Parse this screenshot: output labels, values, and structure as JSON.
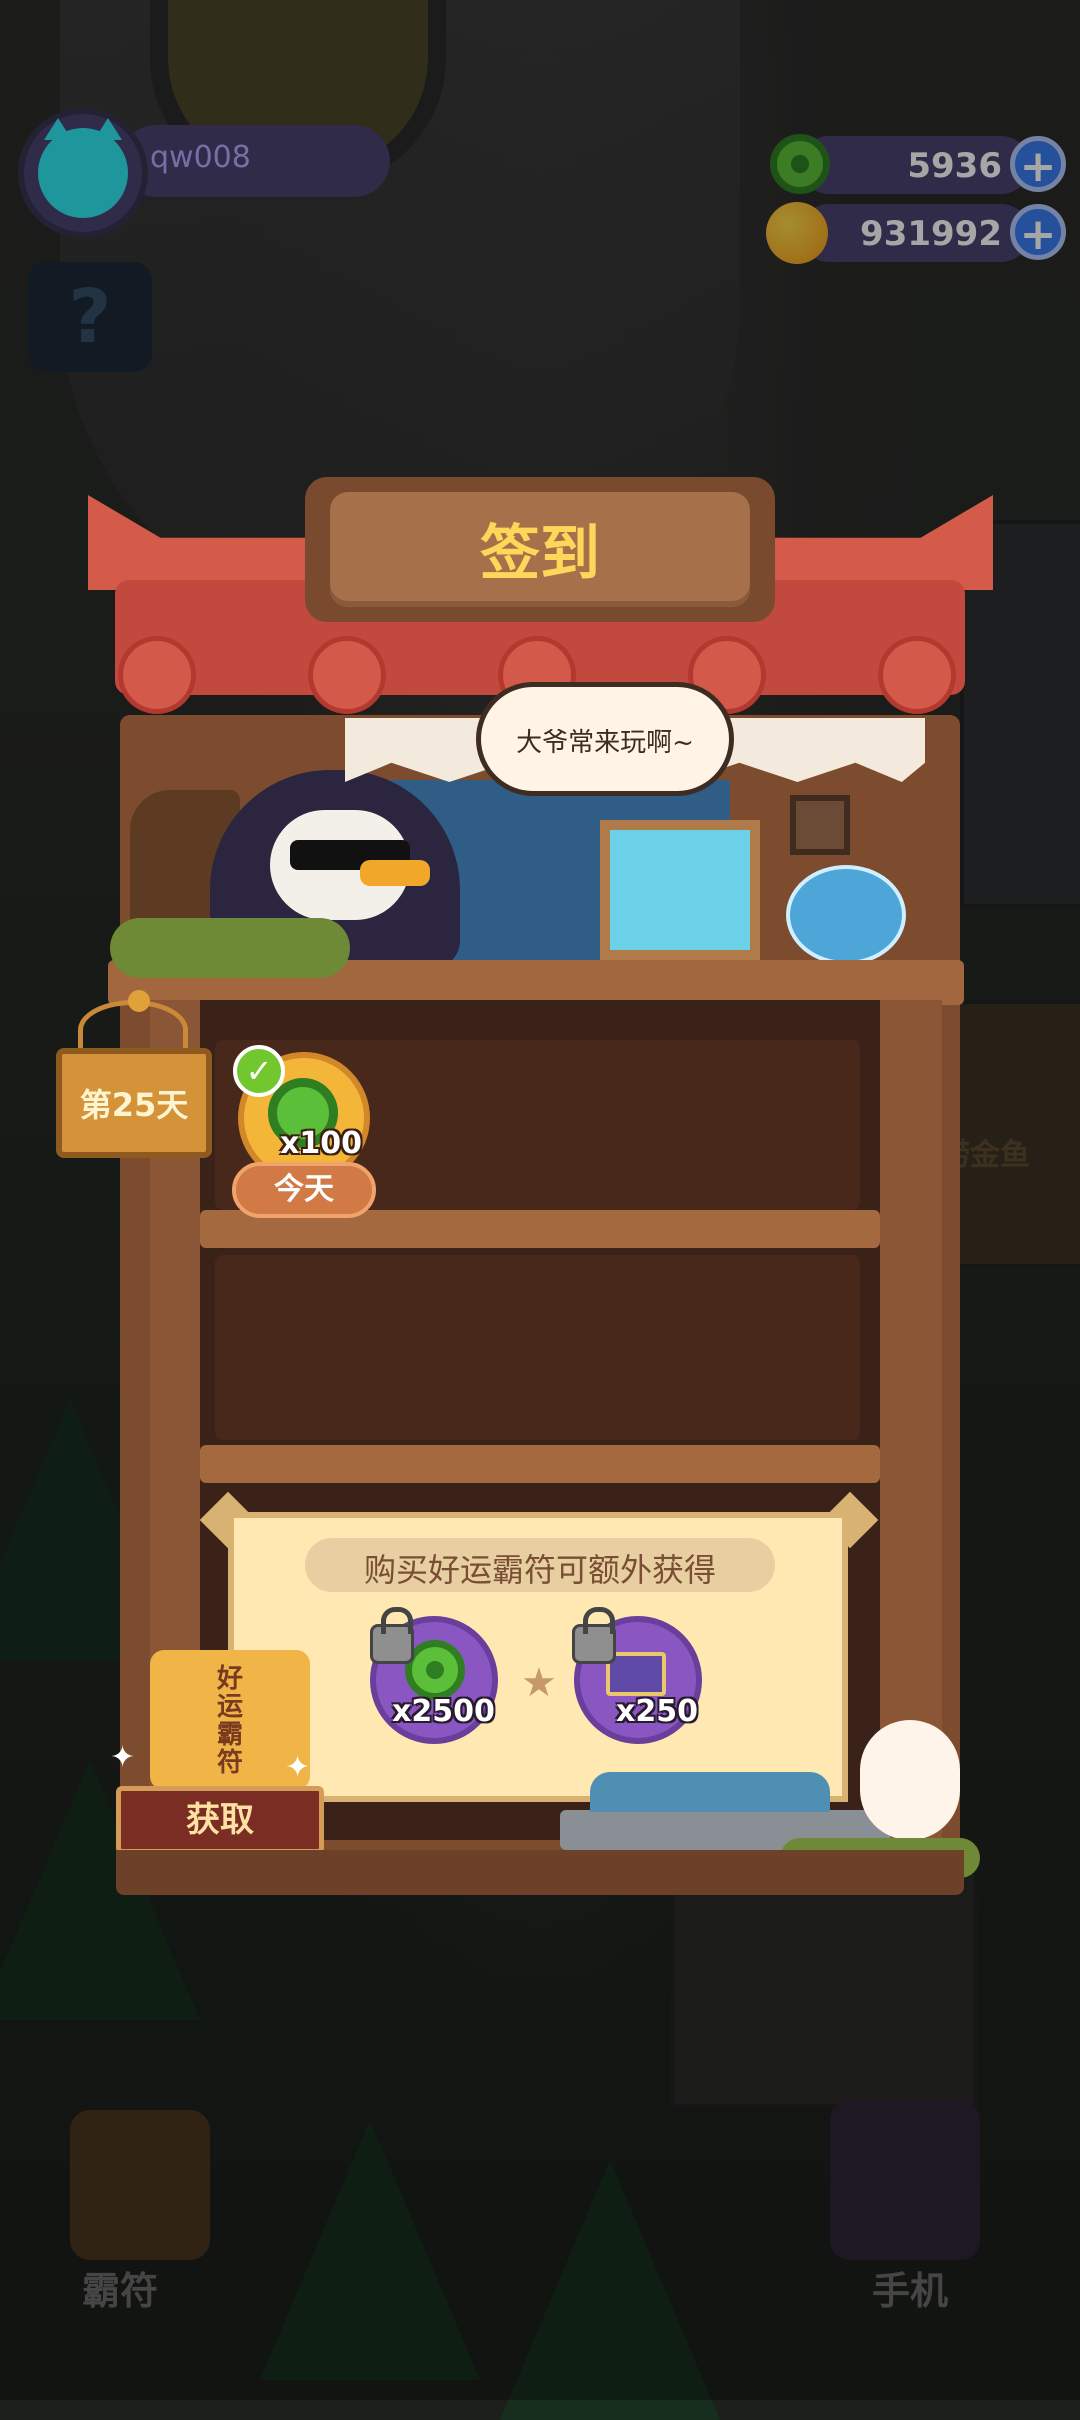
{
  "header": {
    "username": "qw008",
    "currency_jade": "5936",
    "currency_planet": "931992",
    "plus_symbol": "+"
  },
  "mystery": {
    "symbol": "?"
  },
  "modal": {
    "title": "签到",
    "speech": "大爷常来玩啊~",
    "day_label": "第25天",
    "reward": {
      "qty": "x100",
      "today": "今天",
      "claimed": true,
      "check_symbol": "✓"
    },
    "bonus": {
      "title": "购买好运霸符可额外获得",
      "items": [
        {
          "qty": "x2500",
          "icon": "jade-coin-icon"
        },
        {
          "qty": "x250",
          "icon": "ticket-icon"
        }
      ],
      "separator": "★"
    },
    "charm_text": "好运霸符",
    "get_button": "获取"
  },
  "background_hud": {
    "left_label": "霸符",
    "right_label": "手机",
    "shop_sign": "捞金鱼"
  },
  "colors": {
    "title": "#ffd65a",
    "roof": "#c2493d",
    "wood": "#7d4c2e",
    "accent_purple": "#4b4370",
    "plus_blue": "#3a7bf0"
  }
}
